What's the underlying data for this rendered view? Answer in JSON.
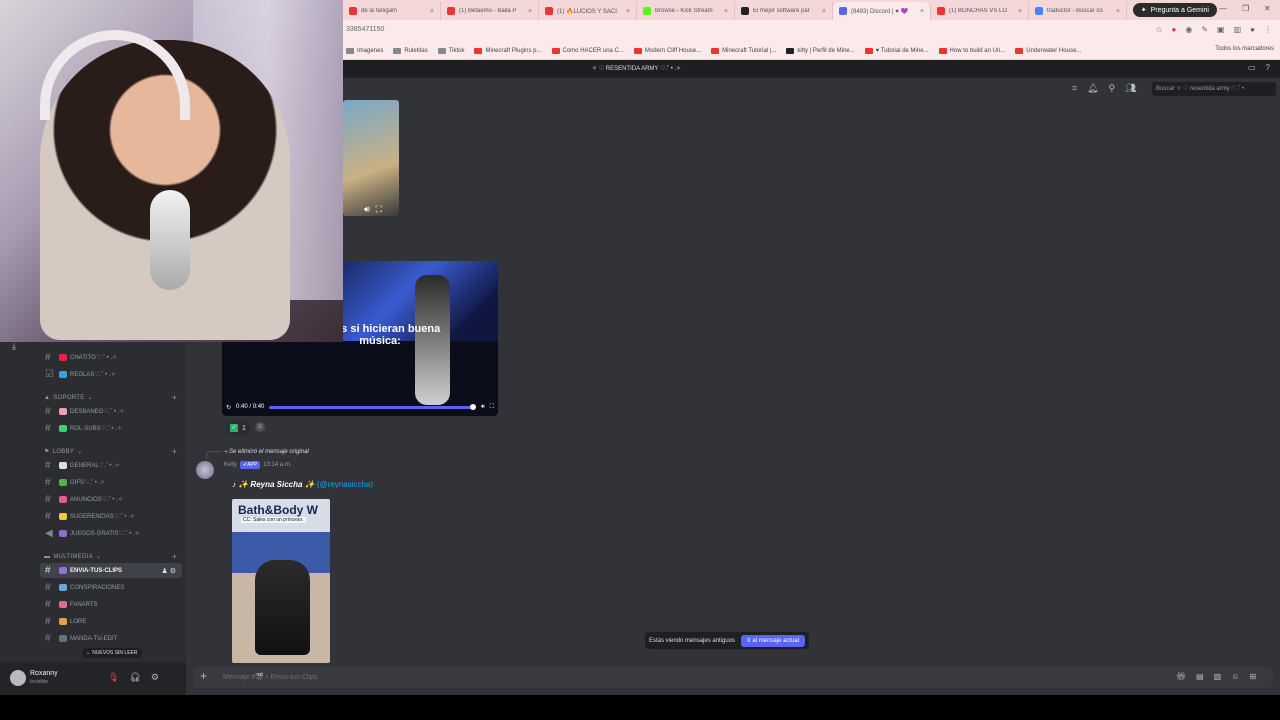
{
  "browser": {
    "tabs": [
      {
        "label": "de la fanigam",
        "color": "#e33"
      },
      {
        "label": "(1) Betaemo - Baila P",
        "color": "#e33"
      },
      {
        "label": "(1) 🔥LUCIOS Y SACI",
        "color": "#e33"
      },
      {
        "label": "Browse - Kick Stream",
        "color": "#53fc18"
      },
      {
        "label": "El mejor software par",
        "color": "#222"
      },
      {
        "label": "(8493) Discord | ♥ 💜",
        "color": "#5865f2"
      },
      {
        "label": "(1) BONCHAS VS LO",
        "color": "#e33"
      },
      {
        "label": "traductor - Buscar co",
        "color": "#4285f4"
      }
    ],
    "new_tab": "+",
    "gemini_label": "Pregunta a Gemini",
    "url": "3385471150",
    "bookmarks": [
      {
        "label": "Imagenes",
        "color": "#888"
      },
      {
        "label": "Ruletitas",
        "color": "#888"
      },
      {
        "label": "Tiktok",
        "color": "#888"
      },
      {
        "label": "Minecraft Plugins p...",
        "color": "#e33"
      },
      {
        "label": "Como HACER una C...",
        "color": "#e33"
      },
      {
        "label": "Modern Cliff House...",
        "color": "#e33"
      },
      {
        "label": "Minecraft Tutorial |...",
        "color": "#e33"
      },
      {
        "label": "kitty | Perfil de Mine...",
        "color": "#222"
      },
      {
        "label": "♥ Tutorial de Mine...",
        "color": "#e33"
      },
      {
        "label": "How to build an Un...",
        "color": "#e33"
      },
      {
        "label": "Underwater House...",
        "color": "#e33"
      }
    ],
    "all_bookmarks": "Todos los marcadores"
  },
  "discord": {
    "server_title": "✧ ♡ RESENTIDA ARMY ♡.˚ • .✧",
    "search_placeholder": "Buscar ✧ ♡ resentida army ♡.˚ •",
    "categories": {
      "soporte": "SOPORTE",
      "lobby": "LOBBY",
      "multimedia": "MULTIMEDIA"
    },
    "channels": {
      "chatito": "CHATITO♡.˚ • .✧",
      "reglas": "REGLAS♡.˚ • .✧",
      "desbaneo": "DESBANEO♡.˚ • .✧",
      "rolsubs": "ROL-SUBS♡.˚ • .✧",
      "general": "GENERAL♡.˚ • .✧",
      "gifs": "GIFS♡.˚ • .✧",
      "anuncios": "ANUNCIOS♡.˚ • .✧",
      "sugerencias": "SUGERENCIAS♡.˚ • .✧",
      "juegos": "JUEGOS-GRATIS♡.˚ • .✧",
      "envia": "ENVIA-TUS-CLIPS",
      "conspiraciones": "CONSPIRACIONES",
      "fanarts": "FANARTS",
      "lore": "LORE",
      "manda": "MANDA-TU-EDIT"
    },
    "unread_pill": "NUEVOS SIN LEER",
    "user": {
      "name": "Roxanny",
      "status": "Invisible"
    },
    "video": {
      "caption": "...kes si hicieran buena música:",
      "time": "0:40 / 0:40",
      "progress": 1.0
    },
    "reaction_count": "1",
    "reply_deleted": "Se eliminó el mensaje original",
    "author": "Kelly",
    "app_badge": "✔APP",
    "timestamp": "13:14 a.m.",
    "embed": {
      "title": "✨ Reyna Siccha ✨",
      "handle": "(@reynasiccha)",
      "thumb_title": "Bath&Body W",
      "thumb_sub": "CC: Sales con un princeso."
    },
    "old_messages_text": "Estás viendo mensajes antiguos",
    "jump_button": "Ir al mensaje actual",
    "composer_placeholder": "Mensaje #🎬 • Envia-tus-Clips"
  }
}
